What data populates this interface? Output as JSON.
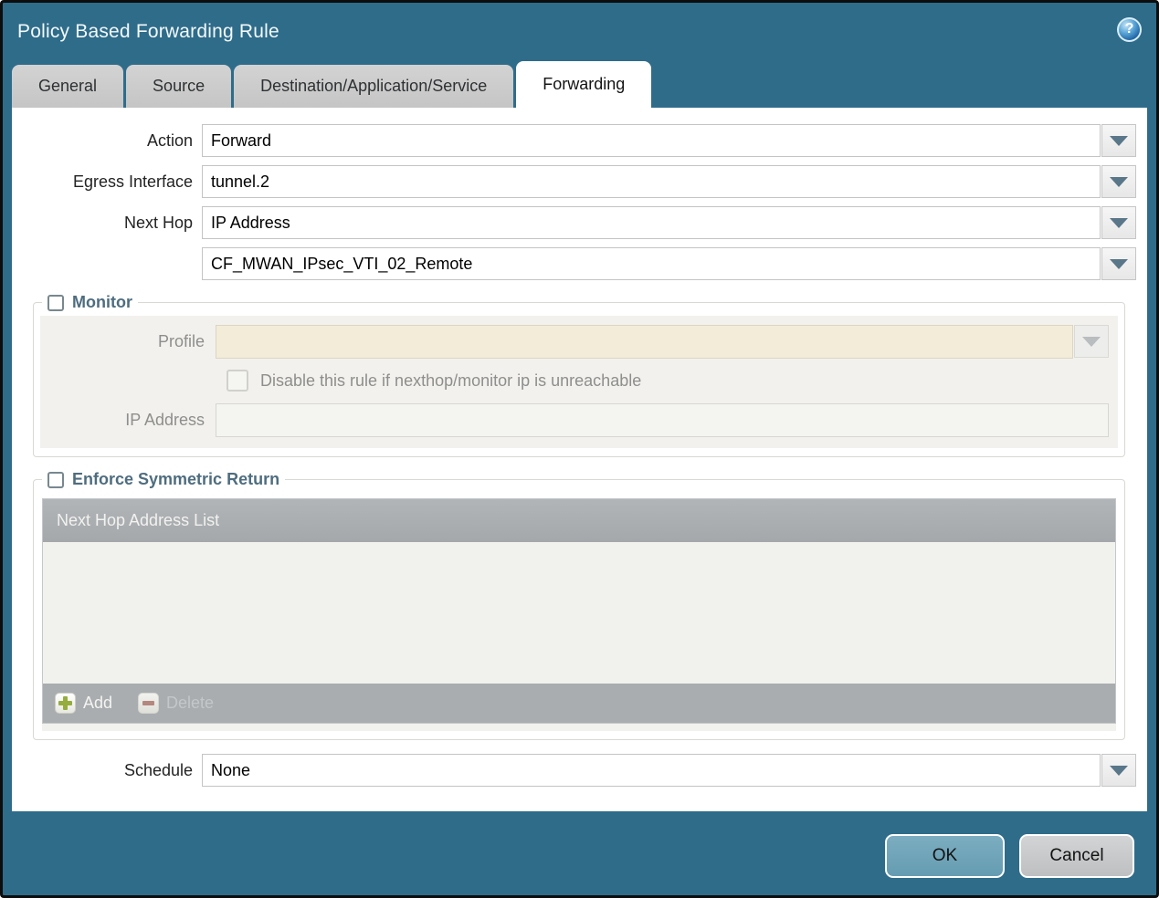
{
  "titlebar": {
    "title": "Policy Based Forwarding Rule",
    "help_glyph": "?"
  },
  "tabs": [
    {
      "label": "General",
      "active": false
    },
    {
      "label": "Source",
      "active": false
    },
    {
      "label": "Destination/Application/Service",
      "active": false
    },
    {
      "label": "Forwarding",
      "active": true
    }
  ],
  "form": {
    "action": {
      "label": "Action",
      "value": "Forward"
    },
    "egress_interface": {
      "label": "Egress Interface",
      "value": "tunnel.2"
    },
    "next_hop": {
      "label": "Next Hop",
      "value": "IP Address"
    },
    "next_hop_value": {
      "value": "CF_MWAN_IPsec_VTI_02_Remote"
    },
    "schedule": {
      "label": "Schedule",
      "value": "None"
    }
  },
  "monitor": {
    "legend": "Monitor",
    "checked": false,
    "profile": {
      "label": "Profile",
      "value": ""
    },
    "disable_rule": {
      "label": "Disable this rule if nexthop/monitor ip is unreachable",
      "checked": false
    },
    "ip_address": {
      "label": "IP Address",
      "value": ""
    }
  },
  "enforce_symmetric_return": {
    "legend": "Enforce Symmetric Return",
    "checked": false,
    "table": {
      "header": "Next Hop Address List",
      "rows": []
    },
    "toolbar": {
      "add_label": "Add",
      "delete_label": "Delete",
      "delete_enabled": false
    }
  },
  "footer": {
    "ok_label": "OK",
    "cancel_label": "Cancel"
  },
  "colors": {
    "titlebar_teal": "#2e6c8a",
    "active_tab": "#ffffff",
    "inactive_tab": "#c9c9c9",
    "legend_text": "#4e6d7f",
    "profile_disabled_bg": "#f2ecd9",
    "table_bar_gray": "#a9adb0",
    "dropdown_arrow": "#5a7689",
    "add_plus_green": "#95ad3e",
    "delete_minus_red": "#a1675c",
    "ok_button": "#6fa6ba",
    "cancel_button": "#c9cbcc"
  }
}
